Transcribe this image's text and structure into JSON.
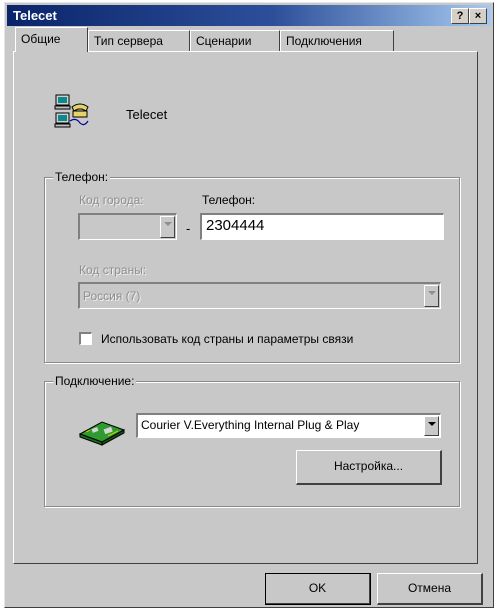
{
  "window": {
    "title": "Telecet",
    "help": "?",
    "close": "×"
  },
  "tabs": [
    {
      "label": "Общие"
    },
    {
      "label": "Тип сервера"
    },
    {
      "label": "Сценарии"
    },
    {
      "label": "Подключения"
    }
  ],
  "connection_name": "Telecet",
  "phone_group": {
    "legend": "Телефон:",
    "area_code_label": "Код города:",
    "area_code_value": "",
    "dash": "-",
    "phone_label": "Телефон:",
    "phone_value": "2304444",
    "country_label": "Код страны:",
    "country_value": "Россия (7)",
    "use_country_checkbox_label": "Использовать код страны и параметры связи",
    "use_country_checked": false
  },
  "connection_group": {
    "legend": "Подключение:",
    "modem_value": "Courier V.Everything Internal Plug & Play",
    "setup_button": "Настройка..."
  },
  "buttons": {
    "ok": "OK",
    "cancel": "Отмена"
  },
  "icons": {
    "phone": "networked-computers-phone-icon",
    "modem": "modem-icon",
    "dropdown": "chevron-down-icon"
  }
}
